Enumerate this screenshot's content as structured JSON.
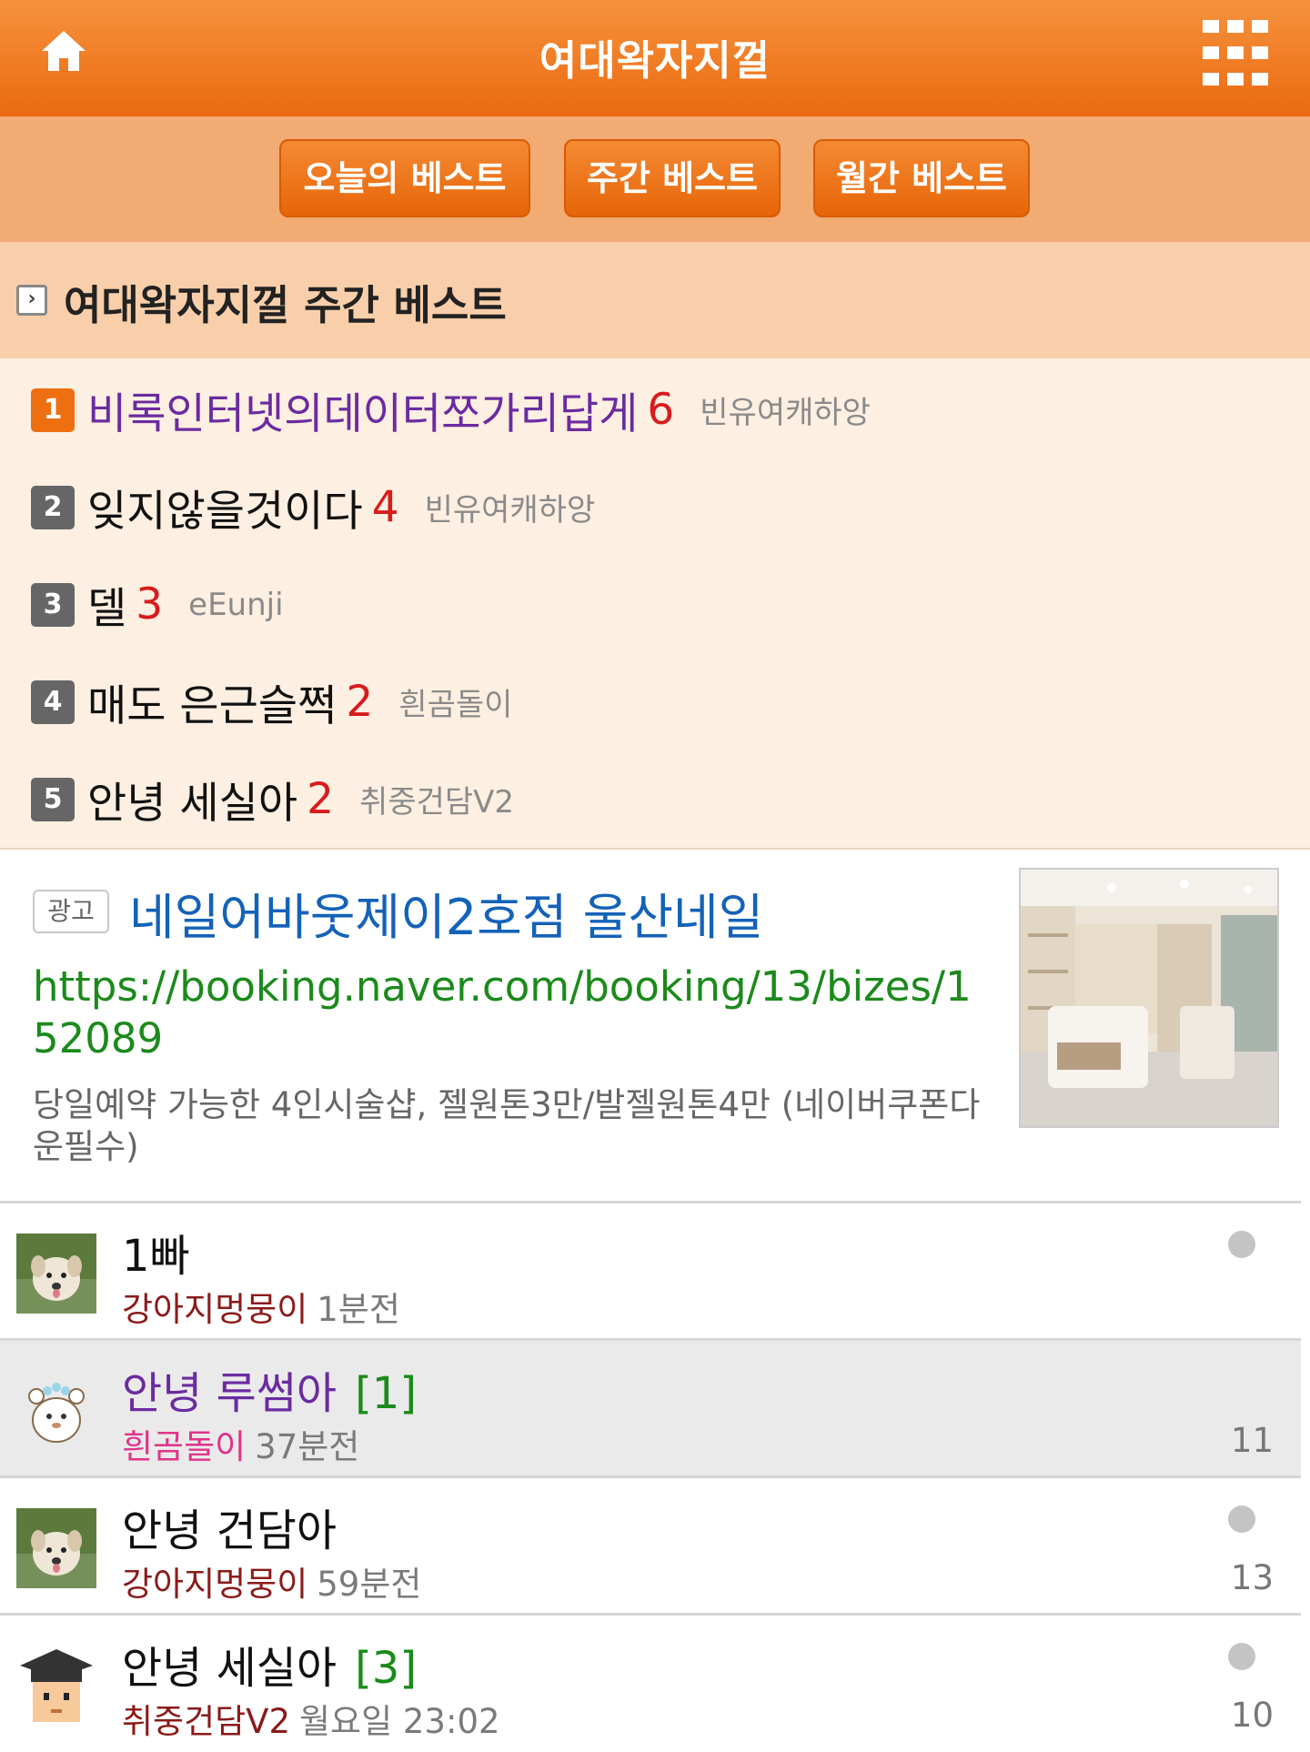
{
  "header": {
    "title": "여대왁자지껄",
    "home_icon": "home-icon",
    "menu_icon": "grid-menu-icon",
    "colors": {
      "bar": "#ea6a0f",
      "tabs_bg": "#f2ab72",
      "section_bg": "#f8cfaa",
      "list_bg": "#fdefe1"
    }
  },
  "tabs": [
    {
      "label": "오늘의 베스트"
    },
    {
      "label": "주간 베스트"
    },
    {
      "label": "월간 베스트"
    }
  ],
  "section": {
    "title": "여대왁자지껄 주간 베스트"
  },
  "best": [
    {
      "rank": "1",
      "title": "비록인터넷의데이터쪼가리답게",
      "count": "6",
      "author": "빈유여캐하앙"
    },
    {
      "rank": "2",
      "title": "잊지않을것이다",
      "count": "4",
      "author": "빈유여캐하앙"
    },
    {
      "rank": "3",
      "title": "델",
      "count": "3",
      "author": "eEunji"
    },
    {
      "rank": "4",
      "title": "매도 은근슬쩍",
      "count": "2",
      "author": "흰곰돌이"
    },
    {
      "rank": "5",
      "title": "안녕 세실아",
      "count": "2",
      "author": "취중건담V2"
    }
  ],
  "ad": {
    "badge": "광고",
    "title": "네일어바웃제이2호점 울산네일",
    "url": "https://booking.naver.com/booking/13/bizes/152089",
    "description": "당일예약 가능한 4인시술샵, 젤원톤3만/발젤원톤4만 (네이버쿠폰다운필수)"
  },
  "posts": [
    {
      "title": "1빠",
      "comments": "",
      "author": "강아지멍뭉이",
      "time": "1분전",
      "views": "",
      "avatar": "puppy-avatar"
    },
    {
      "title": "안녕 루썸아",
      "comments": "[1]",
      "author": "흰곰돌이",
      "time": "37분전",
      "views": "11",
      "avatar": "bear-avatar"
    },
    {
      "title": "안녕 건담아",
      "comments": "",
      "author": "강아지멍뭉이",
      "time": "59분전",
      "views": "13",
      "avatar": "puppy-avatar"
    },
    {
      "title": "안녕 세실아",
      "comments": "[3]",
      "author": "취중건담V2",
      "time": "월요일 23:02",
      "views": "10",
      "avatar": "graduate-avatar"
    }
  ]
}
